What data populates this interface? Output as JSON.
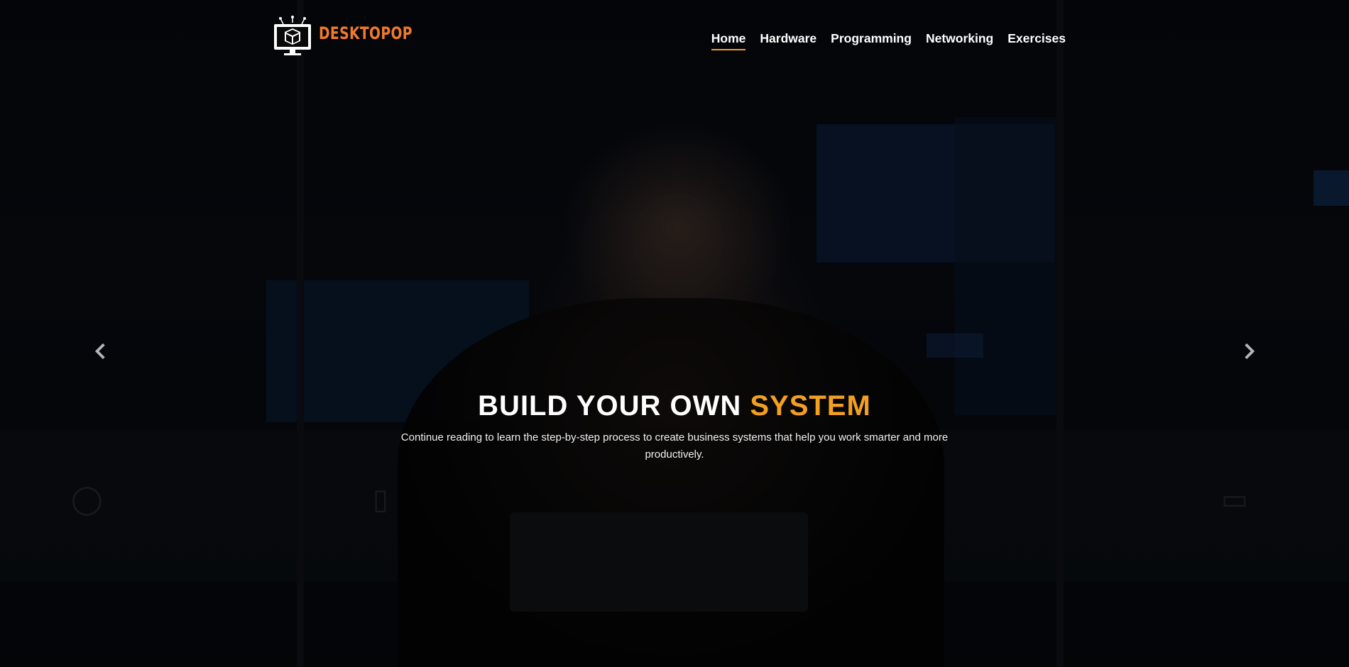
{
  "brand": {
    "name": "DESKTOPOP",
    "logo_icon": "computer-box-icon",
    "accent_color": "#f07a2c"
  },
  "nav": {
    "items": [
      {
        "label": "Home",
        "active": true
      },
      {
        "label": "Hardware",
        "active": false
      },
      {
        "label": "Programming",
        "active": false
      },
      {
        "label": "Networking",
        "active": false
      },
      {
        "label": "Exercises",
        "active": false
      }
    ],
    "active_underline_color": "#f3a020"
  },
  "hero": {
    "title_main": "BUILD YOUR OWN ",
    "title_accent": "SYSTEM",
    "title_accent_color": "#f3a020",
    "description": "Continue reading to learn the step-by-step process to create business systems that help you work smarter and more productively.",
    "prev_icon": "chevron-left-icon",
    "next_icon": "chevron-right-icon"
  }
}
